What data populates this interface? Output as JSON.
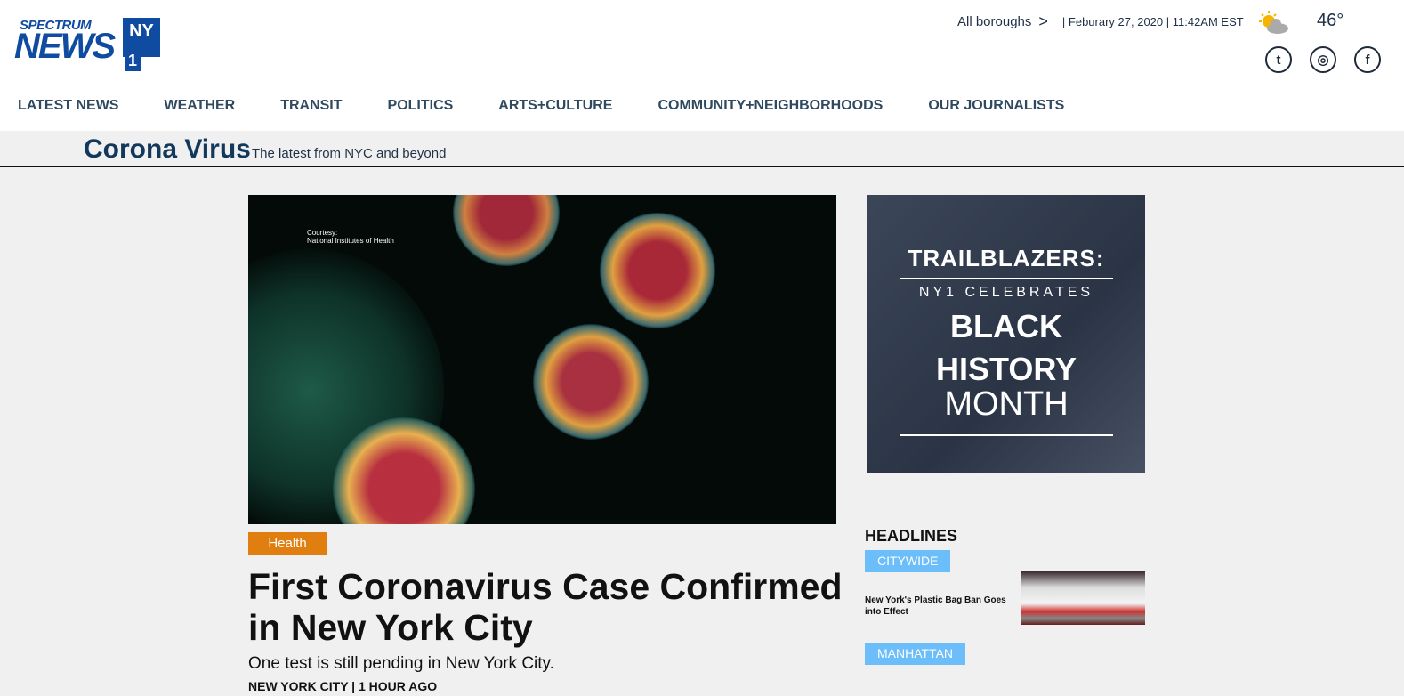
{
  "brand": {
    "line1": "SPECTRUM",
    "line2": "NEWS",
    "ny": "NY",
    "one": "1"
  },
  "top": {
    "boroughs": "All boroughs",
    "chevron": ">",
    "date": "| Feburary 27, 2020 | 11:42AM EST",
    "temp": "46°",
    "weather_icon": "partly-cloudy-icon"
  },
  "social": [
    {
      "name": "twitter",
      "glyph": "t"
    },
    {
      "name": "instagram",
      "glyph": "◎"
    },
    {
      "name": "facebook",
      "glyph": "f"
    }
  ],
  "nav": [
    "LATEST NEWS",
    "WEATHER",
    "TRANSIT",
    "POLITICS",
    "ARTS+CULTURE",
    "COMMUNITY+NEIGHBORHOODS",
    "OUR JOURNALISTS"
  ],
  "banner": {
    "title": "Corona Virus",
    "subtitle": "The latest from NYC and beyond"
  },
  "article": {
    "courtesy1": "Courtesy:",
    "courtesy2": "National Institutes of Health",
    "tag": "Health",
    "title": "First Coronavirus Case Confirmed in New York City",
    "subtitle": "One test is still pending in New York City.",
    "meta": "NEW YORK CITY | 1 HOUR AGO"
  },
  "ad": {
    "l1": "TRAILBLAZERS:",
    "l2": "NY1 CELEBRATES",
    "l3": "BLACK",
    "l4": "HISTORY",
    "l5": "MONTH"
  },
  "headlines": {
    "title": "HEADLINES",
    "sections": [
      "CITYWIDE",
      "MANHATTAN"
    ],
    "story": "New York's Plastic Bag Ban Goes into Effect"
  }
}
